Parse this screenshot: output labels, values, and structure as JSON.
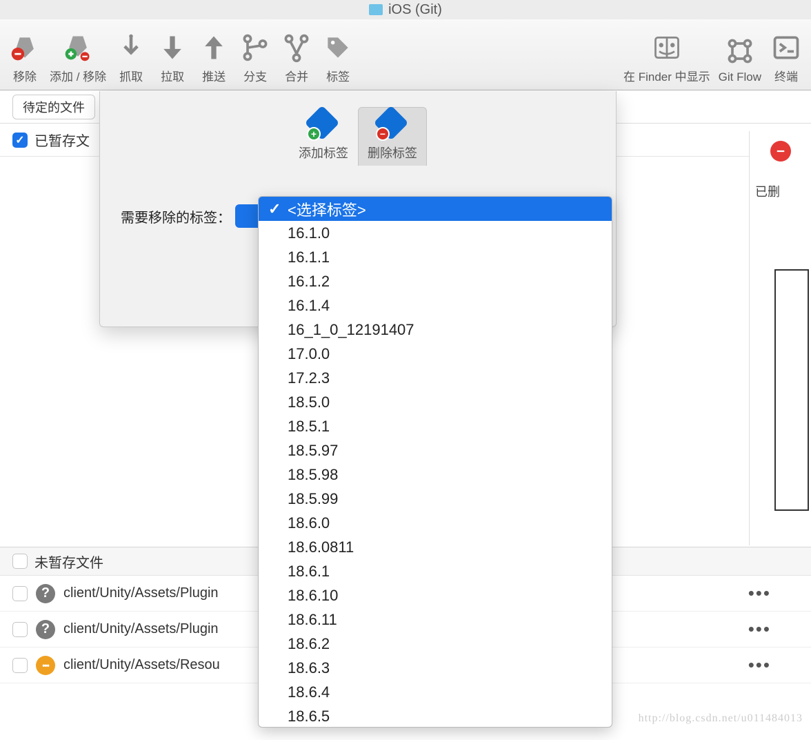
{
  "window": {
    "title": "iOS (Git)"
  },
  "toolbar": [
    {
      "name": "remove",
      "label": "移除",
      "icon": "remove"
    },
    {
      "name": "add-remove",
      "label": "添加 / 移除",
      "icon": "add-remove"
    },
    {
      "name": "fetch",
      "label": "抓取",
      "icon": "fetch"
    },
    {
      "name": "pull",
      "label": "拉取",
      "icon": "pull"
    },
    {
      "name": "push",
      "label": "推送",
      "icon": "push"
    },
    {
      "name": "branch",
      "label": "分支",
      "icon": "branch"
    },
    {
      "name": "merge",
      "label": "合并",
      "icon": "merge"
    },
    {
      "name": "tag",
      "label": "标签",
      "icon": "tag"
    },
    {
      "name": "spacer"
    },
    {
      "name": "show-finder",
      "label": "在 Finder 中显示",
      "icon": "finder"
    },
    {
      "name": "gitflow",
      "label": "Git Flow",
      "icon": "gitflow"
    },
    {
      "name": "terminal",
      "label": "终端",
      "icon": "terminal"
    }
  ],
  "filter": {
    "pending_label": "待定的文件"
  },
  "staged": {
    "label": "已暂存文",
    "checked": true
  },
  "unstaged": {
    "label": "未暂存文件"
  },
  "files": [
    {
      "status": "q",
      "path": "client/Unity/Assets/Plugin"
    },
    {
      "status": "q",
      "path": "client/Unity/Assets/Plugin"
    },
    {
      "status": "m",
      "path": "client/Unity/Assets/Resou"
    }
  ],
  "modal": {
    "tabs": {
      "add": "添加标签",
      "remove": "删除标签"
    },
    "active_tab": "remove",
    "field_label": "需要移除的标签："
  },
  "dropdown": {
    "placeholder": "<选择标签>",
    "items": [
      "16.1.0",
      "16.1.1",
      "16.1.2",
      "16.1.4",
      "16_1_0_12191407",
      "17.0.0",
      "17.2.3",
      "18.5.0",
      "18.5.1",
      "18.5.97",
      "18.5.98",
      "18.5.99",
      "18.6.0",
      "18.6.0811",
      "18.6.1",
      "18.6.10",
      "18.6.11",
      "18.6.2",
      "18.6.3",
      "18.6.4",
      "18.6.5"
    ]
  },
  "right": {
    "text": "已删"
  },
  "watermark": "http://blog.csdn.net/u011484013"
}
